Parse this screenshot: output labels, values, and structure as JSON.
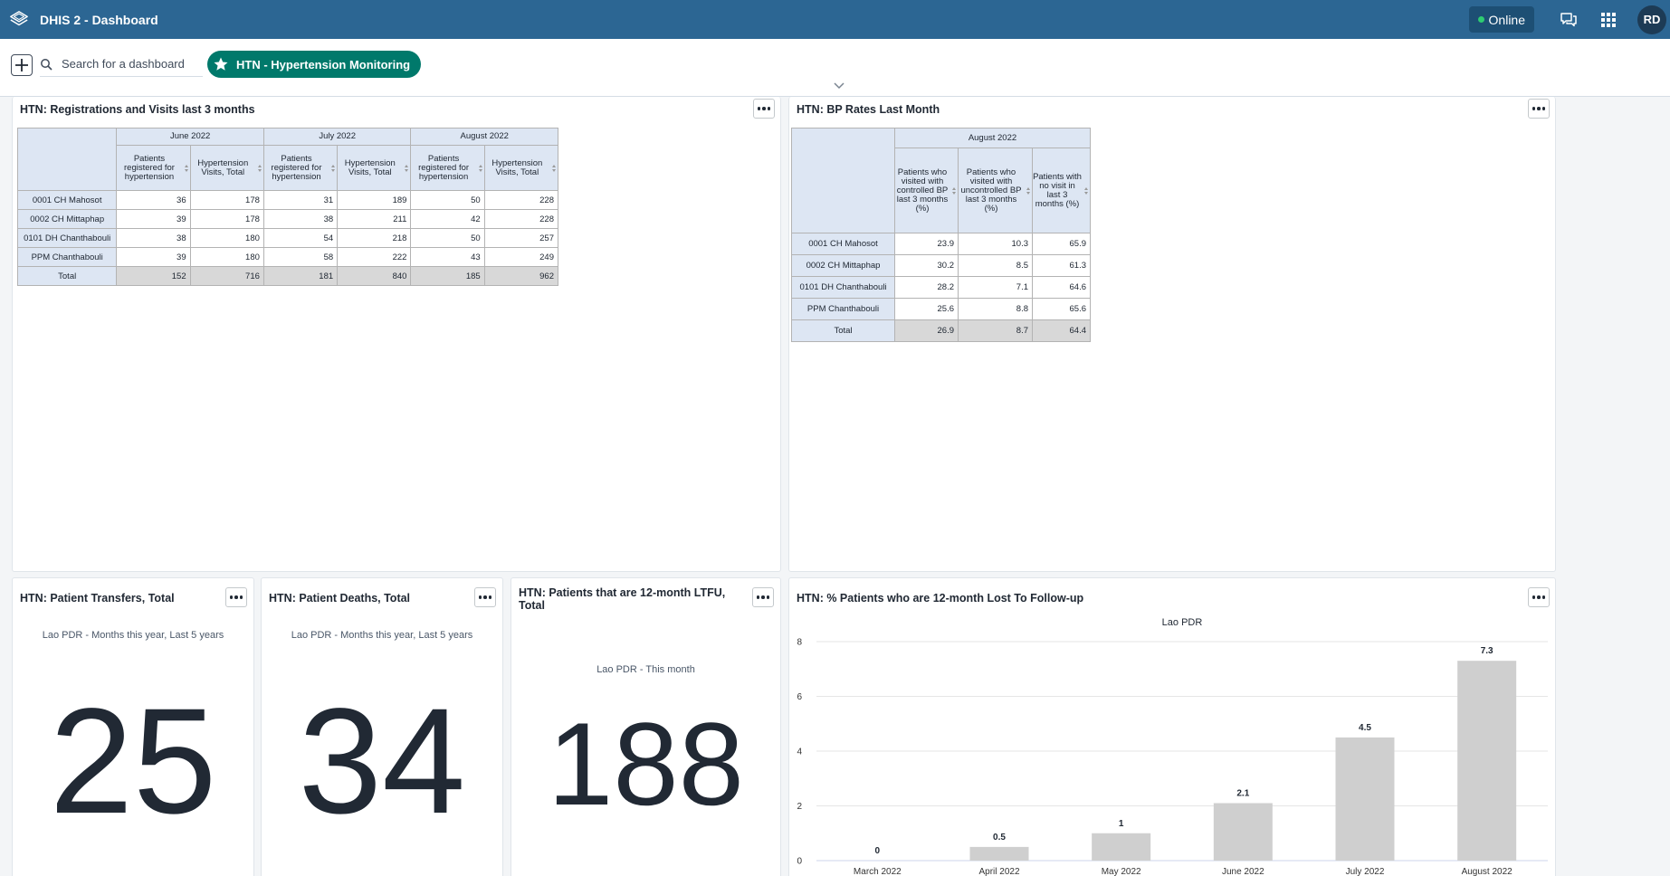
{
  "header": {
    "app_title": "DHIS 2 - Dashboard",
    "online_label": "Online",
    "avatar_initials": "RD",
    "brand_color": "#2c6693"
  },
  "controlbar": {
    "search_placeholder": "Search for a dashboard",
    "selected_dashboard": "HTN - Hypertension Monitoring",
    "chip_color": "#00796b"
  },
  "cards": {
    "registrations": {
      "title": "HTN: Registrations and Visits last 3 months",
      "periods": [
        "June 2022",
        "July 2022",
        "August 2022"
      ],
      "columns": [
        "Patients registered for hypertension",
        "Hypertension Visits, Total"
      ],
      "rows": [
        {
          "label": "0001 CH Mahosot",
          "values": [
            "36",
            "178",
            "31",
            "189",
            "50",
            "228"
          ]
        },
        {
          "label": "0002 CH Mittaphap",
          "values": [
            "39",
            "178",
            "38",
            "211",
            "42",
            "228"
          ]
        },
        {
          "label": "0101 DH Chanthabouli",
          "values": [
            "38",
            "180",
            "54",
            "218",
            "50",
            "257"
          ]
        },
        {
          "label": "PPM Chanthabouli",
          "values": [
            "39",
            "180",
            "58",
            "222",
            "43",
            "249"
          ]
        }
      ],
      "total": {
        "label": "Total",
        "values": [
          "152",
          "716",
          "181",
          "840",
          "185",
          "962"
        ]
      }
    },
    "bp_rates": {
      "title": "HTN: BP Rates Last Month",
      "period": "August 2022",
      "columns": [
        "Patients who visited with controlled BP last 3 months (%)",
        "Patients who visited with uncontrolled BP last 3 months (%)",
        "Patients with no visit in last 3 months (%)"
      ],
      "rows": [
        {
          "label": "0001 CH Mahosot",
          "values": [
            "23.9",
            "10.3",
            "65.9"
          ]
        },
        {
          "label": "0002 CH Mittaphap",
          "values": [
            "30.2",
            "8.5",
            "61.3"
          ]
        },
        {
          "label": "0101 DH Chanthabouli",
          "values": [
            "28.2",
            "7.1",
            "64.6"
          ]
        },
        {
          "label": "PPM Chanthabouli",
          "values": [
            "25.6",
            "8.8",
            "65.6"
          ]
        }
      ],
      "total": {
        "label": "Total",
        "values": [
          "26.9",
          "8.7",
          "64.4"
        ]
      }
    },
    "transfers": {
      "title": "HTN: Patient Transfers, Total",
      "subtitle": "Lao PDR - Months this year, Last 5 years",
      "value": "25"
    },
    "deaths": {
      "title": "HTN: Patient Deaths, Total",
      "subtitle": "Lao PDR - Months this year, Last 5 years",
      "value": "34"
    },
    "ltfu_total": {
      "title": "HTN: Patients that are 12-month LTFU, Total",
      "subtitle": "Lao PDR - This month",
      "value": "188"
    },
    "ltfu_pct": {
      "title": "HTN: % Patients who are 12-month Lost To Follow-up"
    }
  },
  "chart_data": {
    "type": "bar",
    "title": "Lao PDR",
    "categories": [
      "March 2022",
      "April 2022",
      "May 2022",
      "June 2022",
      "July 2022",
      "August 2022"
    ],
    "values": [
      0,
      0.5,
      1,
      2.1,
      4.5,
      7.3
    ],
    "data_labels": [
      "0",
      "0.5",
      "1",
      "2.1",
      "4.5",
      "7.3"
    ],
    "ylim": [
      0,
      8
    ],
    "yticks": [
      "0",
      "2",
      "4",
      "6",
      "8"
    ],
    "grid": true,
    "bar_color": "#cfcfcf"
  }
}
